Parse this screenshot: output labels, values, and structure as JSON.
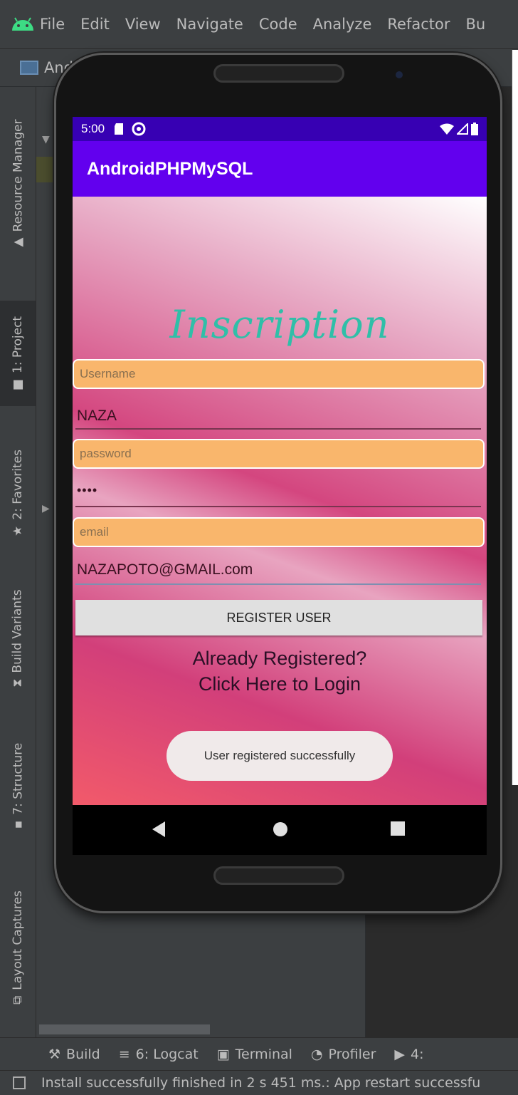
{
  "ide": {
    "menu": [
      {
        "label": "File"
      },
      {
        "label": "Edit"
      },
      {
        "label": "View"
      },
      {
        "label": "Navigate"
      },
      {
        "label": "Code"
      },
      {
        "label": "Analyze"
      },
      {
        "label": "Refactor"
      },
      {
        "label": "Bu"
      }
    ],
    "title_fragment": "And",
    "left_tabs": [
      "Resource Manager",
      "1: Project",
      "2: Favorites",
      "Build Variants",
      "7: Structure",
      "Layout Captures"
    ],
    "bottom_tabs": [
      "Build",
      "6: Logcat",
      "Terminal",
      "Profiler",
      "4:"
    ],
    "status_message": "Install successfully finished in 2 s 451 ms.: App restart successfu"
  },
  "phone": {
    "status_time": "5:00",
    "app_title": "AndroidPHPMySQL",
    "heading": "Inscription",
    "username_placeholder": "Username",
    "username_value": "NAZA",
    "password_placeholder": "password",
    "password_value": "••••",
    "email_placeholder": "email",
    "email_value": "NAZAPOTO@GMAIL.com",
    "register_button": "REGISTER USER",
    "login_line1": "Already Registered?",
    "login_line2": "Click Here to Login",
    "toast": "User registered successfully"
  },
  "colors": {
    "status_bar": "#3700b3",
    "app_bar": "#6200ee",
    "field_bg": "#f9b66c",
    "heading": "#2fbfa8"
  }
}
